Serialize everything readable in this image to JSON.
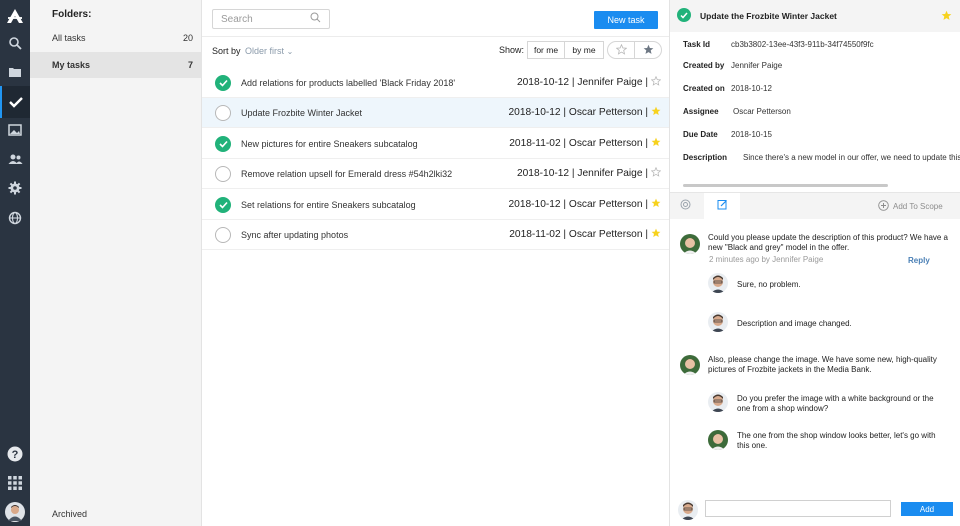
{
  "folders": {
    "heading": "Folders:",
    "items": [
      {
        "label": "All tasks",
        "count": "20"
      },
      {
        "label": "My tasks",
        "count": "7"
      }
    ],
    "archived": "Archived"
  },
  "tasks": {
    "search_placeholder": "Search",
    "new_task": "New task",
    "sort_label": "Sort by",
    "sort_value": "Older first",
    "show_label": "Show:",
    "filter_for_me": "for me",
    "filter_by_me": "by me",
    "rows": [
      {
        "title": "Add relations for products labelled 'Black Friday 2018'",
        "meta": "2018-10-12 | Jennifer Paige |",
        "done": true,
        "starred": false
      },
      {
        "title": "Update Frozbite Winter Jacket",
        "meta": "2018-10-12 | Oscar Petterson |",
        "done": false,
        "starred": true
      },
      {
        "title": "New pictures for entire Sneakers subcatalog",
        "meta": "2018-11-02 | Oscar Petterson |",
        "done": true,
        "starred": true
      },
      {
        "title": "Remove relation upsell for Emerald dress #54h2lki32",
        "meta": "2018-10-12 | Jennifer Paige |",
        "done": false,
        "starred": false
      },
      {
        "title": "Set relations for entire Sneakers subcatalog",
        "meta": "2018-10-12 | Oscar Petterson |",
        "done": true,
        "starred": true
      },
      {
        "title": "Sync after updating photos",
        "meta": "2018-11-02 | Oscar Petterson |",
        "done": false,
        "starred": true
      }
    ]
  },
  "detail": {
    "title": "Update the Frozbite Winter Jacket",
    "fields": {
      "task_id_label": "Task Id",
      "task_id": "cb3b3802-13ee-43f3-911b-34f74550f9fc",
      "created_by_label": "Created by",
      "created_by": "Jennifer Paige",
      "created_on_label": "Created on",
      "created_on": "2018-10-12",
      "assignee_label": "Assignee",
      "assignee": "Oscar Petterson",
      "due_label": "Due Date",
      "due": "2018-10-15",
      "description_label": "Description",
      "description": "Since there's a new model in our offer, we need to update this description"
    },
    "add_to_scope": "Add To Scope",
    "comments": {
      "c1": "Could you please update the description of this product? We have a new \"Black and grey\" model in the offer.",
      "c1_time": "2 minutes ago by Jennifer Paige",
      "reply": "Reply",
      "r1": "Sure, no problem.",
      "r2": "Description and image changed.",
      "c2": "Also, please change the image. We have some new, high-quality pictures of Frozbite jackets in the Media Bank.",
      "r3": "Do you prefer the image with a white background or the one from a shop window?",
      "r4": "The one from the shop window looks better, let's go with this one."
    },
    "add_button": "Add"
  },
  "colors": {
    "rail": "#2a3441",
    "accent": "#1a8cf0",
    "done_green": "#21b27a",
    "star": "#f7d21e"
  }
}
